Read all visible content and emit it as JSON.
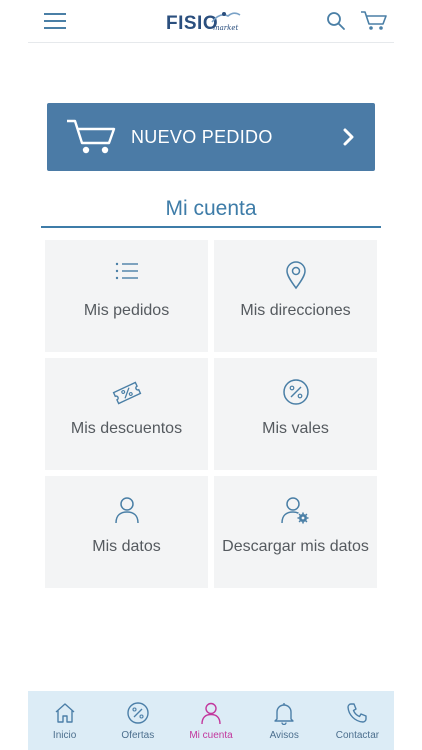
{
  "colors": {
    "accent": "#4b7ba6",
    "title": "#3e7ca8",
    "tile_bg": "#f3f4f5",
    "nav_bg": "#dcecf6",
    "nav_active": "#c2379d"
  },
  "header": {
    "logo_text": "FISIO",
    "logo_sub": "market",
    "icons": [
      "menu-icon",
      "search-icon",
      "cart-icon"
    ]
  },
  "banner": {
    "label": "NUEVO PEDIDO",
    "icons": [
      "cart-icon",
      "chevron-right-icon"
    ]
  },
  "account": {
    "title": "Mi cuenta",
    "tiles": [
      {
        "label": "Mis pedidos",
        "icon": "list-icon"
      },
      {
        "label": "Mis direcciones",
        "icon": "location-pin-icon"
      },
      {
        "label": "Mis descuentos",
        "icon": "discount-ticket-icon"
      },
      {
        "label": "Mis vales",
        "icon": "percent-icon"
      },
      {
        "label": "Mis datos",
        "icon": "user-icon"
      },
      {
        "label": "Descargar mis datos",
        "icon": "user-settings-icon"
      }
    ]
  },
  "bottom_nav": {
    "items": [
      {
        "label": "Inicio",
        "icon": "home-icon"
      },
      {
        "label": "Ofertas",
        "icon": "percent-icon"
      },
      {
        "label": "Mi cuenta",
        "icon": "user-icon",
        "active": true
      },
      {
        "label": "Avisos",
        "icon": "bell-icon"
      },
      {
        "label": "Contactar",
        "icon": "phone-icon"
      }
    ]
  }
}
